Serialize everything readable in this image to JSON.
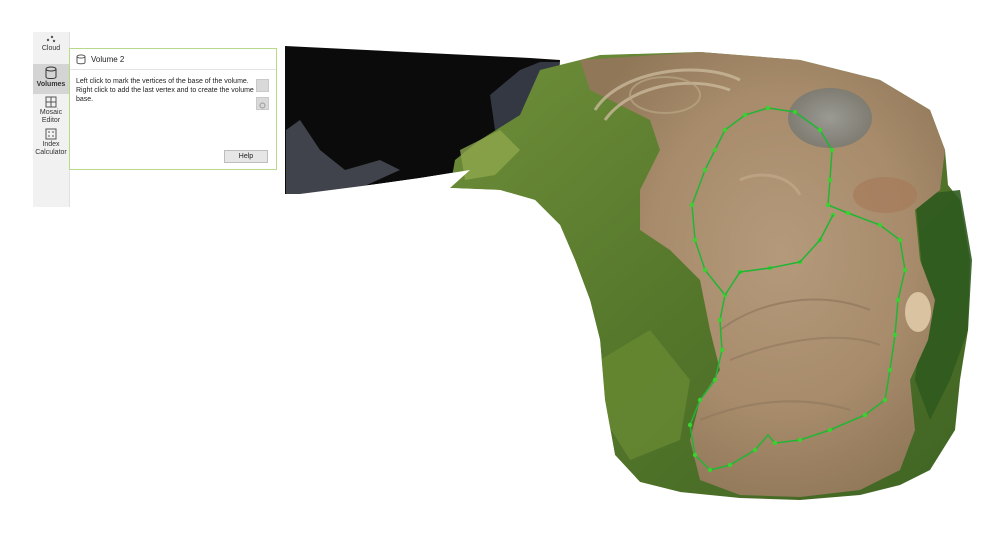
{
  "toolbar": {
    "items": [
      {
        "label": "Cloud",
        "icon": "point-cloud-icon"
      },
      {
        "label": "Volumes",
        "icon": "volumes-icon"
      },
      {
        "label": "Mosaic\nEditor",
        "icon": "mosaic-editor-icon"
      },
      {
        "label": "Index\nCalculator",
        "icon": "index-calculator-icon"
      }
    ],
    "active": "Volumes"
  },
  "panel": {
    "title": "Volume 2",
    "instructions": "Left click to mark the vertices of the base of the volume. Right click to add the last vertex and to create the volume base.",
    "help_label": "Help"
  },
  "colors": {
    "panel_border": "#b9d98a",
    "vertex_marker": "#39d22f",
    "outline": "#22b534",
    "soil": "#a98e6f",
    "vegetation": "#5d7d33"
  }
}
